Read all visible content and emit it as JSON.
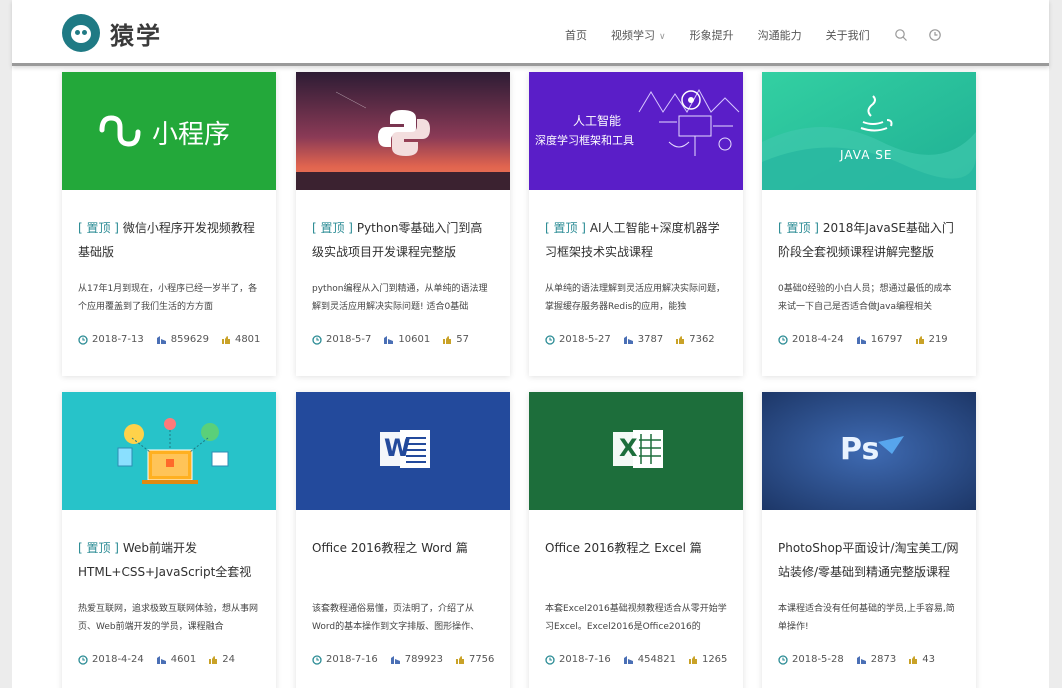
{
  "header": {
    "brand": "猿学",
    "nav": [
      {
        "label": "首页"
      },
      {
        "label": "视频学习",
        "has_dropdown": true
      },
      {
        "label": "形象提升"
      },
      {
        "label": "沟通能力"
      },
      {
        "label": "关于我们"
      }
    ],
    "icons": [
      "search-icon",
      "clock-icon"
    ]
  },
  "cards": [
    {
      "tag": "[ 置顶 ]",
      "title": "微信小程序开发视频教程基础版",
      "desc": "从17年1月到现在，小程序已经一岁半了，各个应用覆盖到了我们生活的方方面",
      "date": "2018-7-13",
      "views": "859629",
      "likes": "4801",
      "thumb": {
        "text": "小程序",
        "color": "#23a83a"
      }
    },
    {
      "tag": "[ 置顶 ]",
      "title": "Python零基础入门到高级实战项目开发课程完整版",
      "desc": "python编程从入门到精通，从单纯的语法理解到灵活应用解决实际问题! 适合0基础",
      "date": "2018-5-7",
      "views": "10601",
      "likes": "57",
      "thumb": {
        "color": "#3a2540"
      }
    },
    {
      "tag": "[ 置顶 ]",
      "title": "AI人工智能+深度机器学习框架技术实战课程",
      "desc": "从单纯的语法理解到灵活应用解决实际问题，掌握缓存服务器Redis的应用，能独",
      "date": "2018-5-27",
      "views": "3787",
      "likes": "7362",
      "thumb": {
        "line1": "人工智能",
        "line2": "深度学习框架和工具",
        "color": "#5a1ec8"
      }
    },
    {
      "tag": "[ 置顶 ]",
      "title": "2018年JavaSE基础入门阶段全套视频课程讲解完整版",
      "desc": "0基础0经验的小白人员；想通过最低的成本来试一下自己是否适合做Java编程相关",
      "date": "2018-4-24",
      "views": "16797",
      "likes": "219",
      "thumb": {
        "text": "JAVA SE",
        "color": "#2fc59c"
      }
    },
    {
      "tag": "[ 置顶 ]",
      "title": "Web前端开发HTML+CSS+JavaScript全套视频精英课程",
      "desc": "热爱互联网，追求极致互联网体验，想从事网页、Web前端开发的学员，课程融合",
      "date": "2018-4-24",
      "views": "4601",
      "likes": "24",
      "thumb": {
        "color": "#27c3c9"
      }
    },
    {
      "tag": "",
      "title": "Office 2016教程之 Word 篇",
      "desc": "该套教程通俗易懂，页法明了，介绍了从Word的基本操作到文字排版、图形操作、",
      "date": "2018-7-16",
      "views": "789923",
      "likes": "7756",
      "thumb": {
        "text": "W",
        "color": "#234a9c"
      }
    },
    {
      "tag": "",
      "title": "Office 2016教程之 Excel 篇",
      "desc": "本套Excel2016基础视频教程适合从零开始学习Excel。Excel2016是Office2016的",
      "date": "2018-7-16",
      "views": "454821",
      "likes": "1265",
      "thumb": {
        "text": "X",
        "color": "#1d6e3b"
      }
    },
    {
      "tag": "",
      "title": "PhotoShop平面设计/淘宝美工/网站装修/零基础到精通完整版课程",
      "desc": "本课程适合没有任何基础的学员,上手容易,简单操作!",
      "date": "2018-5-28",
      "views": "2873",
      "likes": "43",
      "thumb": {
        "text": "Ps",
        "color": "#2d4f8a"
      }
    }
  ],
  "colors": {
    "accent": "#2a8b94",
    "icon": "#2a8b94"
  }
}
